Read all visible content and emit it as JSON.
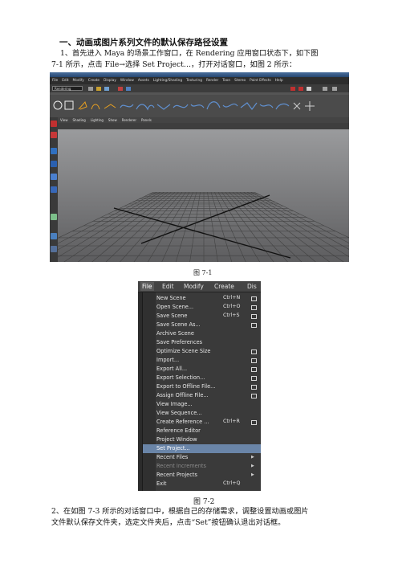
{
  "heading": "一、动画或图片系列文件的默认保存路径设置",
  "para1": {
    "line1": "1、首先进入 Maya 的场景工作窗口，在 Rendering 应用窗口状态下，如下图",
    "line2": "7-1 所示，点击 File→选择 Set Project…，打开对话窗口，如图 2 所示："
  },
  "figure1": {
    "caption": "图 7-1",
    "menubar": [
      "File",
      "Edit",
      "Modify",
      "Create",
      "Display",
      "Window",
      "Assets",
      "Lighting/Shading",
      "Texturing",
      "Render",
      "Toon",
      "Stereo",
      "Paint Effects",
      "Help"
    ],
    "mode_selector": "Rendering",
    "panel_menu": [
      "View",
      "Shading",
      "Lighting",
      "Show",
      "Renderer",
      "Panels"
    ]
  },
  "figure2": {
    "caption": "图 7-2",
    "menubar": [
      "File",
      "Edit",
      "Modify",
      "Create",
      "Dis"
    ],
    "items": [
      {
        "label": "New Scene",
        "shortcut": "Ctrl+N",
        "option_box": true
      },
      {
        "label": "Open Scene...",
        "shortcut": "Ctrl+O",
        "option_box": true
      },
      {
        "label": "Save Scene",
        "shortcut": "Ctrl+S",
        "option_box": true
      },
      {
        "label": "Save Scene As...",
        "shortcut": "",
        "option_box": true
      },
      {
        "label": "Archive Scene",
        "shortcut": "",
        "option_box": false
      },
      {
        "label": "Save Preferences",
        "shortcut": "",
        "option_box": false
      },
      {
        "label": "Optimize Scene Size",
        "shortcut": "",
        "option_box": true
      },
      {
        "label": "Import...",
        "shortcut": "",
        "option_box": true
      },
      {
        "label": "Export All...",
        "shortcut": "",
        "option_box": true
      },
      {
        "label": "Export Selection...",
        "shortcut": "",
        "option_box": true
      },
      {
        "label": "Export to Offline File...",
        "shortcut": "",
        "option_box": true
      },
      {
        "label": "Assign Offline File...",
        "shortcut": "",
        "option_box": true
      },
      {
        "label": "View Image...",
        "shortcut": "",
        "option_box": false
      },
      {
        "label": "View Sequence...",
        "shortcut": "",
        "option_box": false
      },
      {
        "label": "Create Reference ...",
        "shortcut": "Ctrl+R",
        "option_box": true
      },
      {
        "label": "Reference Editor",
        "shortcut": "",
        "option_box": false
      },
      {
        "label": "Project Window",
        "shortcut": "",
        "option_box": false
      },
      {
        "label": "Set Project...",
        "shortcut": "",
        "option_box": false,
        "highlighted": true
      },
      {
        "label": "Recent Files",
        "shortcut": "",
        "submenu": true
      },
      {
        "label": "Recent Increments",
        "shortcut": "",
        "submenu": true,
        "disabled": true
      },
      {
        "label": "Recent Projects",
        "shortcut": "",
        "submenu": true
      },
      {
        "label": "Exit",
        "shortcut": "Ctrl+Q",
        "option_box": false
      }
    ]
  },
  "para2": {
    "line1": "2、在如图 7-3 所示的对话窗口中，根据自己的存储需求，调整设置动画或图片",
    "line2": "文件默认保存文件夹，选定文件夹后，点击“Set”按钮确认退出对话框。"
  },
  "colors": {
    "viewport_bg": "#7f7f80",
    "menu_bg": "#3a3a3a",
    "menu_highlight": "#6a85a8"
  }
}
